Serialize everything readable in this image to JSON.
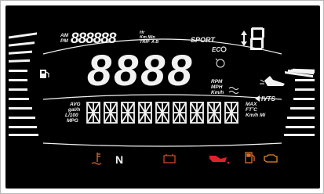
{
  "display": {
    "am_label": "AM",
    "pm_label": "PM",
    "hr_label": "Hr",
    "km_min_label": "Km Min",
    "trip_label": "TRIP",
    "trip_ab_label": "A B",
    "sport_label": "SPORT",
    "eco_label": "EC",
    "rpm_label": "RPM",
    "mph_label": "MPH",
    "kmh_label": "Km/h",
    "avg_label": "AVG",
    "galh_label": "gal/h",
    "l100_label": "L/100",
    "mpg_label": "MPG",
    "max_label": "MAX",
    "ftc_label": "FT˚C",
    "kmh_mi_label": "Km/h Mi",
    "rpm_mph_label": "RPMPH",
    "ivts_label": "IVTS",
    "big_digits": "8888",
    "trip_digits": "888888"
  },
  "indicators": {
    "neutral": "N"
  },
  "colors": {
    "segment": "#f2f2f2",
    "panel": "#000000",
    "water_temp": "#e06a2a",
    "neutral": "#1fa53a",
    "battery": "#e04a2a",
    "oil": "#e0202a",
    "fuel": "#e0702a",
    "engine": "#e08a2a"
  }
}
